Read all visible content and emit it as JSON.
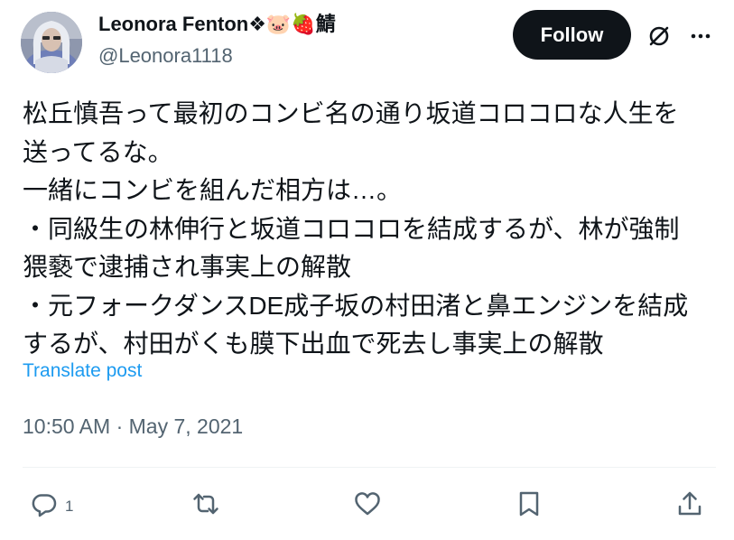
{
  "author": {
    "display_name": "Leonora Fenton❖🐷🍓鯖",
    "handle": "@Leonora1118"
  },
  "header": {
    "follow_label": "Follow",
    "grok_icon": "grok-slash-circle-icon",
    "more_icon": "more-dots-icon"
  },
  "post": {
    "lines": [
      "松丘慎吾って最初のコンビ名の通り坂道コロコロな人生を",
      "送ってるな。",
      "一緒にコンビを組んだ相方は…。",
      "・同級生の林伸行と坂道コロコロを結成するが、林が強制",
      "猥褻で逮捕され事実上の解散",
      "・元フォークダンスDE成子坂の村田渚と鼻エンジンを結成",
      "するが、村田がくも膜下出血で死去し事実上の解散"
    ],
    "translate_label": "Translate post",
    "timestamp": "10:50 AM · May 7, 2021"
  },
  "actions": {
    "reply_count": "1",
    "icons": [
      "reply-icon",
      "repost-icon",
      "like-icon",
      "bookmark-icon",
      "share-icon"
    ]
  },
  "colors": {
    "text": "#0f1419",
    "secondary": "#536471",
    "link": "#1d9bf0",
    "button_bg": "#0f1419"
  }
}
